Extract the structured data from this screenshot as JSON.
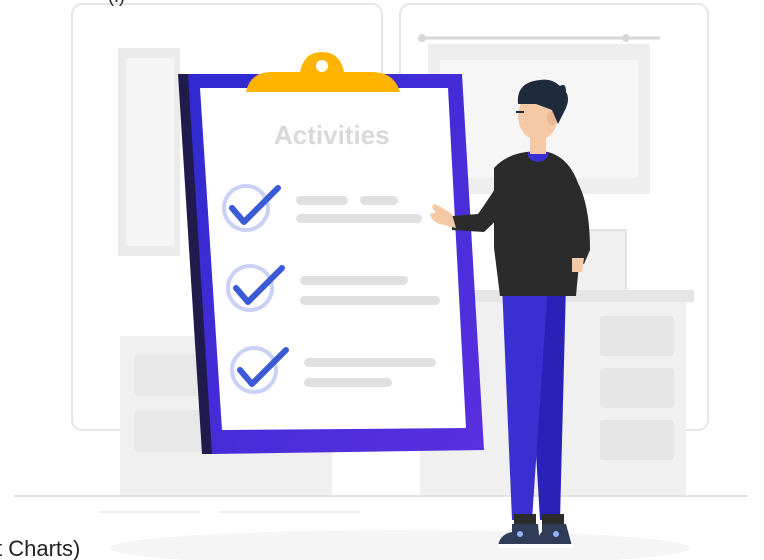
{
  "clipboard": {
    "title": "Activities",
    "checklist": [
      {
        "checked": true,
        "line_count": 2
      },
      {
        "checked": true,
        "line_count": 2
      },
      {
        "checked": true,
        "line_count": 2
      }
    ]
  },
  "cropped_text": {
    "top_fragment": "(.)",
    "bottom_fragment": "t Charts)"
  },
  "colors": {
    "clipboard_frame": "#3a2fd0",
    "clipboard_frame_dark": "#1f1b4d",
    "clip": "#ffb400",
    "checkmark": "#3b5bd6",
    "check_circle": "#c9d2f5",
    "text_placeholder": "#e0e0e0",
    "title_text": "#d9d9d9",
    "background_shapes": "#f2f2f2",
    "background_lines": "#e6e6e6",
    "shirt": "#2b2b2b",
    "pants": "#3a2fd0",
    "skin": "#f6c9a6",
    "hair": "#1f2a3c"
  }
}
